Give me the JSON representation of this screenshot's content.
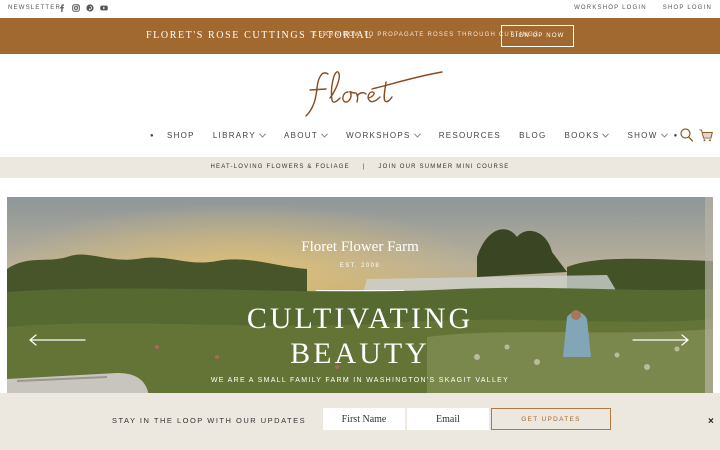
{
  "topbar": {
    "newsletter": "NEWSLETTER",
    "social_icons": [
      "facebook-icon",
      "instagram-icon",
      "pinterest-icon",
      "youtube-icon"
    ],
    "workshop_login": "WORKSHOP LOGIN",
    "shop_login": "SHOP LOGIN"
  },
  "promo": {
    "title": "FLORET'S ROSE CUTTINGS TUTORIAL",
    "subtitle": "LEARN HOW TO PROPAGATE ROSES THROUGH CUTTINGS",
    "button": "SIGN UP NOW",
    "color": "#a1692f"
  },
  "logo": {
    "text": "floret"
  },
  "nav": {
    "items": [
      {
        "label": "SHOP",
        "dropdown": false
      },
      {
        "label": "LIBRARY",
        "dropdown": true
      },
      {
        "label": "ABOUT",
        "dropdown": true
      },
      {
        "label": "WORKSHOPS",
        "dropdown": true
      },
      {
        "label": "RESOURCES",
        "dropdown": false
      },
      {
        "label": "BLOG",
        "dropdown": false
      },
      {
        "label": "BOOKS",
        "dropdown": true
      },
      {
        "label": "SHOW",
        "dropdown": true
      }
    ],
    "search_icon": "search-icon",
    "cart_icon": "cart-icon"
  },
  "strip": {
    "left": "HEAT-LOVING FLOWERS & FOLIAGE",
    "separator": "|",
    "right": "JOIN OUR SUMMER MINI COURSE"
  },
  "hero": {
    "farm_name": "Floret Flower Farm",
    "est": "EST. 2008",
    "headline_1": "CULTIVATING",
    "headline_2": "BEAUTY",
    "tagline": "WE ARE A SMALL FAMILY FARM IN WASHINGTON'S SKAGIT VALLEY"
  },
  "newsletter": {
    "title": "STAY IN THE LOOP WITH OUR UPDATES",
    "first_name_placeholder": "First Name",
    "email_placeholder": "Email",
    "button": "GET UPDATES",
    "close": "×"
  }
}
